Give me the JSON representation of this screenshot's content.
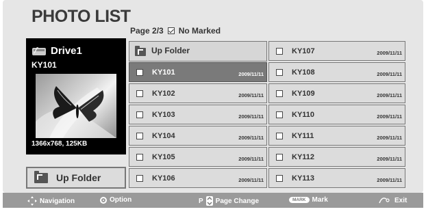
{
  "title": "PHOTO LIST",
  "page_info": {
    "page": "Page 2/3",
    "marked": "No Marked"
  },
  "preview": {
    "drive": "Drive1",
    "file": "KY101",
    "info": "1366x768, 125KB"
  },
  "up_folder_big": "Up Folder",
  "list": {
    "up_folder": "Up Folder",
    "left_column": [
      {
        "name": "KY101",
        "date": "2009/11/11",
        "selected": true
      },
      {
        "name": "KY102",
        "date": "2009/11/11",
        "selected": false
      },
      {
        "name": "KY103",
        "date": "2009/11/11",
        "selected": false
      },
      {
        "name": "KY104",
        "date": "2009/11/11",
        "selected": false
      },
      {
        "name": "KY105",
        "date": "2009/11/11",
        "selected": false
      },
      {
        "name": "KY106",
        "date": "2009/11/11",
        "selected": false
      }
    ],
    "right_column": [
      {
        "name": "KY107",
        "date": "2009/11/11"
      },
      {
        "name": "KY108",
        "date": "2009/11/11"
      },
      {
        "name": "KY109",
        "date": "2009/11/11"
      },
      {
        "name": "KY110",
        "date": "2009/11/11"
      },
      {
        "name": "KY111",
        "date": "2009/11/11"
      },
      {
        "name": "KY112",
        "date": "2009/11/11"
      },
      {
        "name": "KY113",
        "date": "2009/11/11"
      }
    ]
  },
  "footer": {
    "navigation": "Navigation",
    "option": "Option",
    "p_key": "P",
    "page_change": "Page Change",
    "mark_key": "MARK",
    "mark": "Mark",
    "exit": "Exit"
  }
}
